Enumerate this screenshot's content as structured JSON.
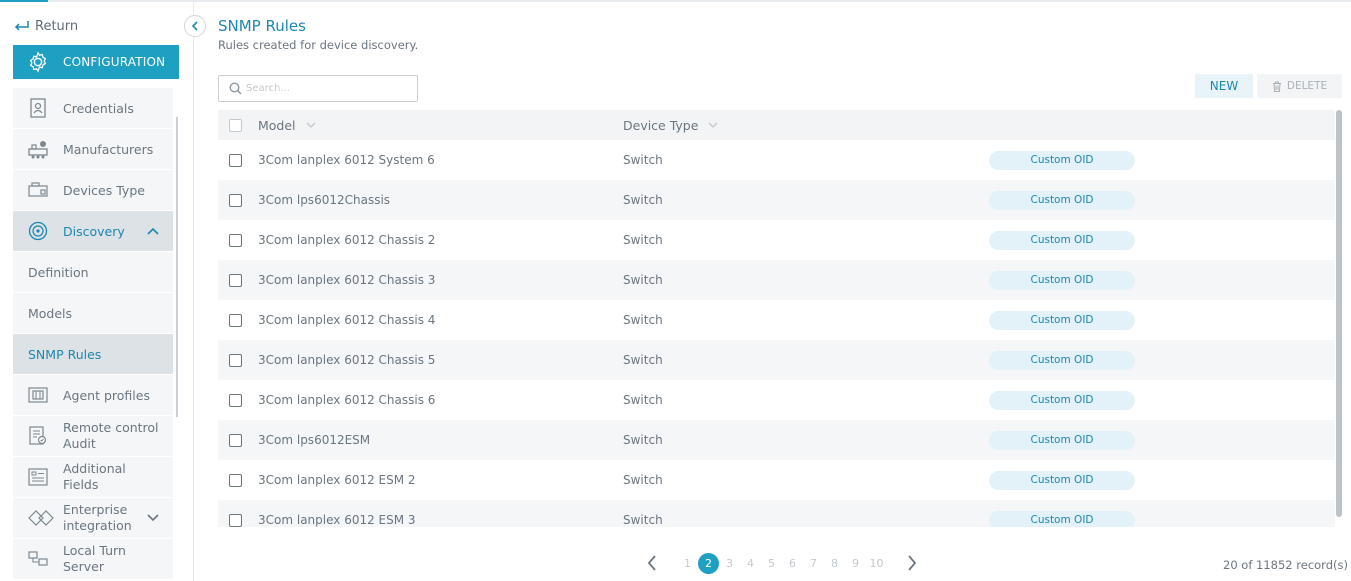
{
  "sidebar": {
    "return_label": "Return",
    "config_label": "CONFIGURATION",
    "items": [
      {
        "label": "Credentials",
        "icon": "badge-icon"
      },
      {
        "label": "Manufacturers",
        "icon": "factory-icon"
      },
      {
        "label": "Devices Type",
        "icon": "devices-icon"
      },
      {
        "label": "Discovery",
        "icon": "radar-icon"
      },
      {
        "label": "Definition"
      },
      {
        "label": "Models"
      },
      {
        "label": "SNMP Rules"
      },
      {
        "label": "Agent profiles",
        "icon": "agent-icon"
      },
      {
        "label_1": "Remote control",
        "label_2": "Audit",
        "icon": "audit-icon"
      },
      {
        "label_1": "Additional",
        "label_2": "Fields",
        "icon": "fields-icon"
      },
      {
        "label_1": "Enterprise",
        "label_2": "integration",
        "icon": "integration-icon"
      },
      {
        "label_1": "Local Turn",
        "label_2": "Server",
        "icon": "server-icon"
      }
    ]
  },
  "header": {
    "title": "SNMP Rules",
    "subtitle": "Rules created for device discovery."
  },
  "search": {
    "placeholder": "Search..."
  },
  "toolbar": {
    "new_label": "NEW",
    "delete_label": "DELETE"
  },
  "table": {
    "columns": [
      "Model",
      "Device Type"
    ],
    "rows": [
      {
        "model": "3Com lanplex 6012 System 6",
        "type": "Switch",
        "badge": "Custom OID"
      },
      {
        "model": "3Com lps6012Chassis",
        "type": "Switch",
        "badge": "Custom OID"
      },
      {
        "model": "3Com lanplex 6012 Chassis 2",
        "type": "Switch",
        "badge": "Custom OID"
      },
      {
        "model": "3Com lanplex 6012 Chassis 3",
        "type": "Switch",
        "badge": "Custom OID"
      },
      {
        "model": "3Com lanplex 6012 Chassis 4",
        "type": "Switch",
        "badge": "Custom OID"
      },
      {
        "model": "3Com lanplex 6012 Chassis 5",
        "type": "Switch",
        "badge": "Custom OID"
      },
      {
        "model": "3Com lanplex 6012 Chassis 6",
        "type": "Switch",
        "badge": "Custom OID"
      },
      {
        "model": "3Com lps6012ESM",
        "type": "Switch",
        "badge": "Custom OID"
      },
      {
        "model": "3Com lanplex 6012 ESM 2",
        "type": "Switch",
        "badge": "Custom OID"
      },
      {
        "model": "3Com lanplex 6012 ESM 3",
        "type": "Switch",
        "badge": "Custom OID"
      }
    ]
  },
  "pagination": {
    "pages": [
      "1",
      "2",
      "3",
      "4",
      "5",
      "6",
      "7",
      "8",
      "9",
      "10"
    ],
    "current": "2",
    "records": "20 of 11852 record(s)"
  },
  "colors": {
    "accent": "#1ea0c3",
    "link": "#1c87b0"
  }
}
